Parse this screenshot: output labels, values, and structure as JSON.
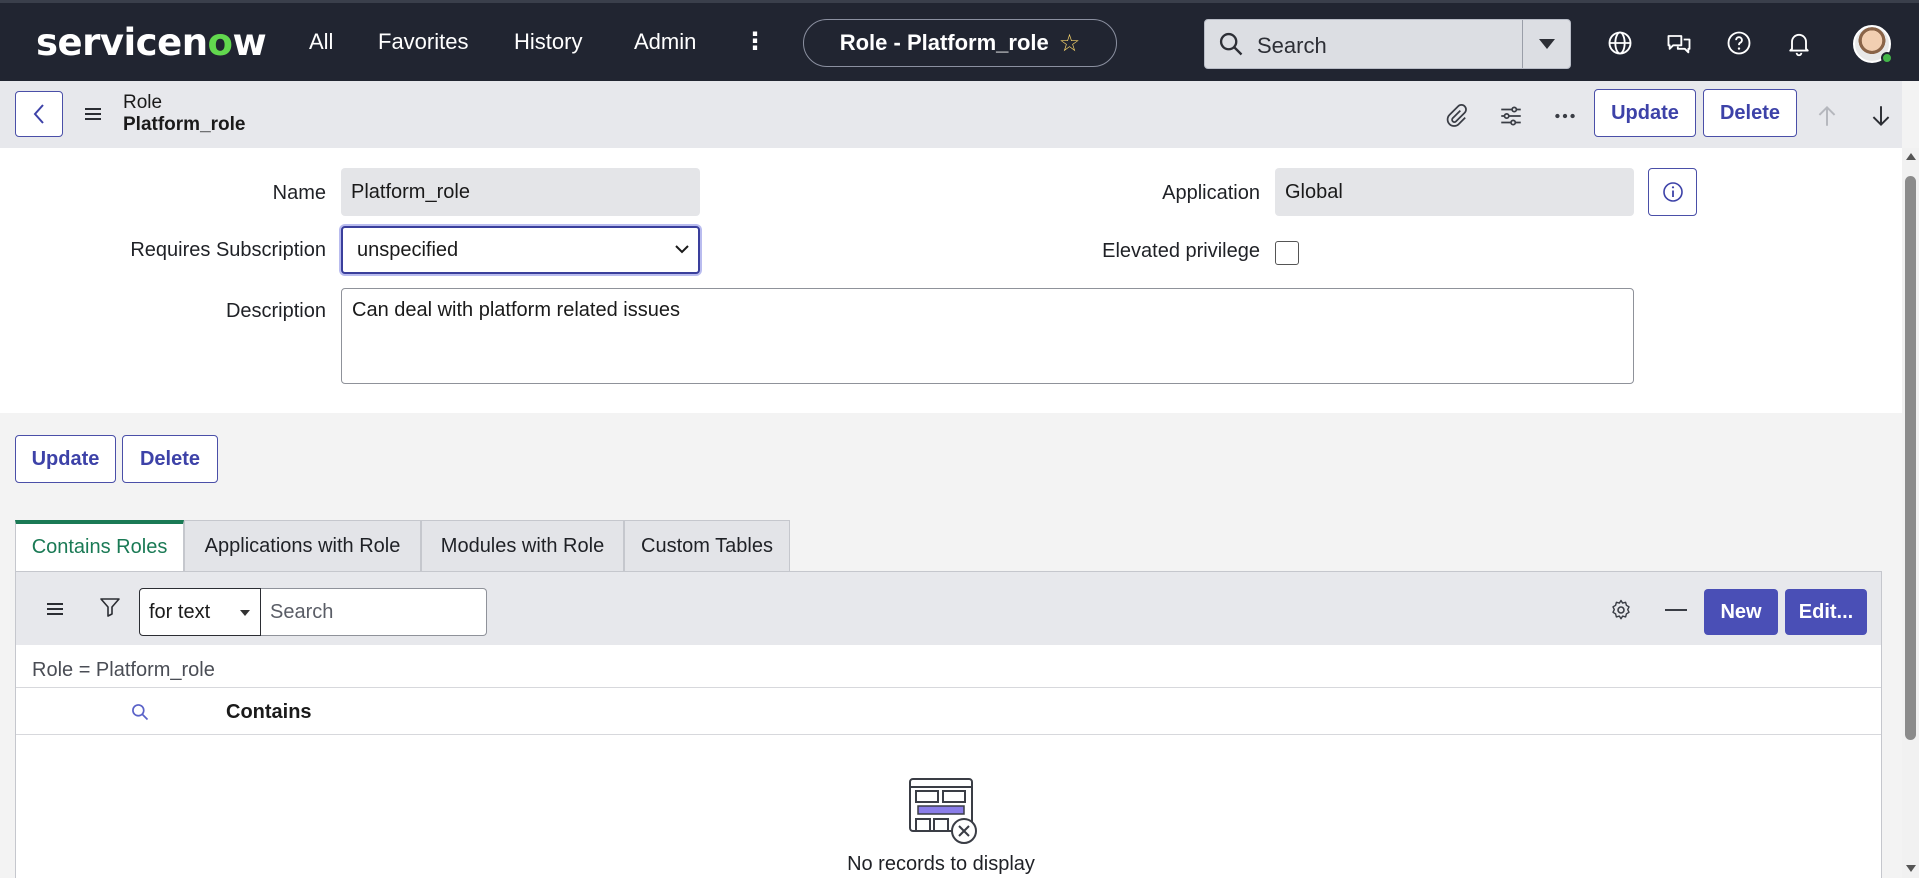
{
  "nav": {
    "logo_pre": "servicen",
    "logo_o": "o",
    "logo_post": "w",
    "all": "All",
    "favorites": "Favorites",
    "history": "History",
    "admin": "Admin",
    "more": "⋮",
    "context_title": "Role - Platform_role",
    "search_placeholder": "Search"
  },
  "header": {
    "crumb_table": "Role",
    "crumb_record": "Platform_role",
    "update_label": "Update",
    "delete_label": "Delete"
  },
  "form": {
    "name_label": "Name",
    "name_value": "Platform_role",
    "subscription_label": "Requires Subscription",
    "subscription_value": "unspecified",
    "application_label": "Application",
    "application_value": "Global",
    "elevated_label": "Elevated privilege",
    "elevated_checked": false,
    "description_label": "Description",
    "description_value": "Can deal with platform related issues"
  },
  "actions": {
    "update_label": "Update",
    "delete_label": "Delete"
  },
  "tabs": [
    {
      "label": "Contains Roles",
      "active": true
    },
    {
      "label": "Applications with Role",
      "active": false
    },
    {
      "label": "Modules with Role",
      "active": false
    },
    {
      "label": "Custom Tables",
      "active": false
    }
  ],
  "related_list": {
    "search_field": "for text",
    "search_placeholder": "Search",
    "new_label": "New",
    "edit_label": "Edit...",
    "filter_breadcrumb": "Role = Platform_role",
    "column_header": "Contains",
    "empty_message": "No records to display"
  },
  "colors": {
    "nav_bg": "#212531",
    "accent": "#4a4fb6",
    "active_tab": "#1a7a55"
  }
}
